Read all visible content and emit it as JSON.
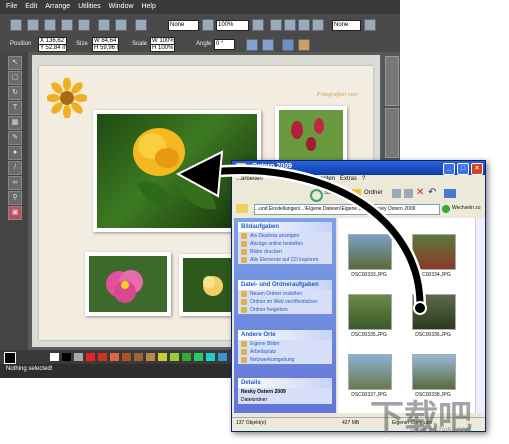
{
  "editor": {
    "menu": [
      "File",
      "Edit",
      "Arrange",
      "Utilities",
      "Window",
      "Help"
    ],
    "toolbar1": {
      "style_field": "None",
      "zoom_field": "100%",
      "font_field": "None"
    },
    "toolbar2": {
      "position_label": "Position",
      "size_label": "Size",
      "scale_label": "Scale",
      "angle_label": "Angle",
      "pos_x": "X 136,62 mm",
      "pos_y": "Y 52,84 mm",
      "size_w": "W 84,64 mm",
      "size_h": "H 59,96 mm",
      "scale_w": "W 100%",
      "scale_h": "H 100%",
      "angle": "0 °"
    },
    "status": "Nothing selected!",
    "page_heading": "Fotografiert von:"
  },
  "explorer": {
    "title": "Ostern 2009",
    "menu": [
      "...arbeiten",
      "Ansicht",
      "Favoriten",
      "Extras",
      "?"
    ],
    "toolbar": {
      "search": "Suchen",
      "folders": "Ordner"
    },
    "address": "...und Einstellungen\\...\\Eigene Dateien\\Eigene Bilder\\Nesky Ostern 2009",
    "go_label": "Wechseln zu",
    "tasks": [
      {
        "header": "Bildaufgaben",
        "items": [
          "Als Diashow anzeigen",
          "Abzüge online bestellen",
          "Bilder drucken",
          "Alle Elemente auf CD kopieren"
        ]
      },
      {
        "header": "Datei- und Ordneraufgaben",
        "items": [
          "Neuen Ordner erstellen",
          "Ordner im Web veröffentlichen",
          "Ordner freigeben"
        ]
      },
      {
        "header": "Andere Orte",
        "items": [
          "Eigene Bilder",
          "Arbeitsplatz",
          "Netzwerkumgebung"
        ]
      },
      {
        "header": "Details",
        "items": [
          "Nesky Ostern 2009",
          "Dateiordner"
        ]
      }
    ],
    "files": [
      "DSC00333.JPG",
      "DSC00334.JPG",
      "DSC00335.JPG",
      "DSC00336.JPG",
      "DSC00337.JPG",
      "DSC00338.JPG"
    ],
    "status": {
      "count": "137 Objekt(e)",
      "size": "427 MB",
      "location": "Eigener Computer"
    }
  },
  "watermark": {
    "text": "WWW.XIAZAIBA.COM"
  }
}
